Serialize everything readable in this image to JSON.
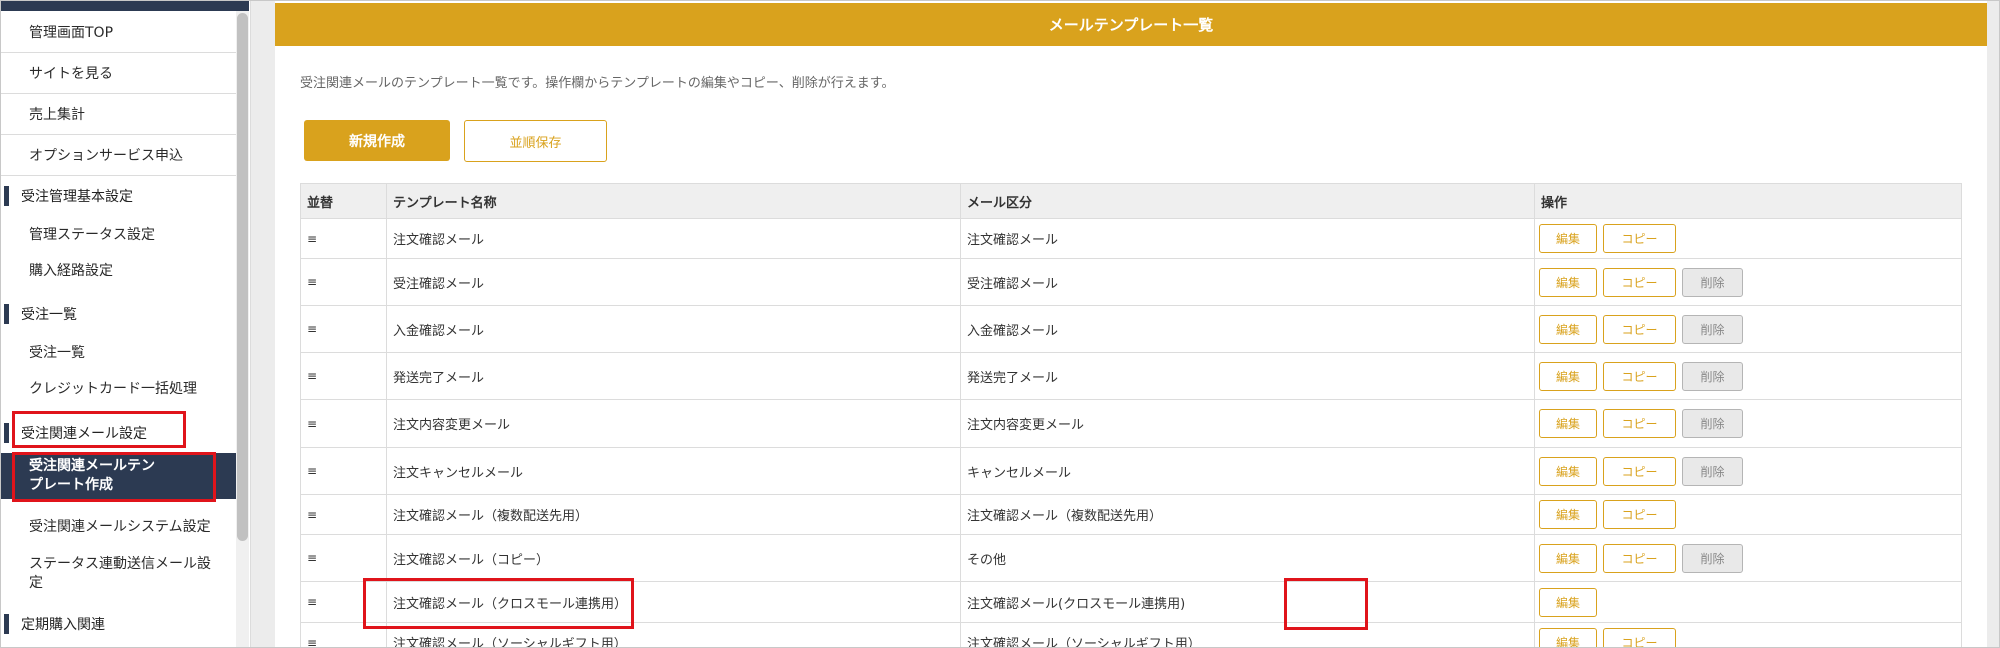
{
  "sidebar": {
    "items": [
      {
        "label": "管理画面TOP"
      },
      {
        "label": "サイトを見る"
      },
      {
        "label": "売上集計"
      },
      {
        "label": "オプションサービス申込"
      }
    ],
    "sections": [
      {
        "title": "受注管理基本設定",
        "items": [
          "管理ステータス設定",
          "購入経路設定"
        ]
      },
      {
        "title": "受注一覧",
        "items": [
          "受注一覧",
          "クレジットカード一括処理"
        ]
      },
      {
        "title": "受注関連メール設定",
        "items": [
          "受注関連メールテンプレート作成",
          "受注関連メールシステム設定",
          "ステータス連動送信メール設定"
        ]
      },
      {
        "title": "定期購入関連",
        "items": []
      }
    ]
  },
  "panel": {
    "title": "メールテンプレート一覧",
    "description": "受注関連メールのテンプレート一覧です。操作欄からテンプレートの編集やコピー、削除が行えます。",
    "new_button": "新規作成",
    "order_save_button": "並順保存"
  },
  "table": {
    "headers": [
      "並替",
      "テンプレート名称",
      "メール区分",
      "操作"
    ],
    "handle_symbol": "≡",
    "edit_label": "編集",
    "copy_label": "コピー",
    "delete_label": "削除",
    "rows": [
      {
        "name": "注文確認メール",
        "type": "注文確認メール",
        "copy": true,
        "delete": false
      },
      {
        "name": "受注確認メール",
        "type": "受注確認メール",
        "copy": true,
        "delete": true
      },
      {
        "name": "入金確認メール",
        "type": "入金確認メール",
        "copy": true,
        "delete": true
      },
      {
        "name": "発送完了メール",
        "type": "発送完了メール",
        "copy": true,
        "delete": true
      },
      {
        "name": "注文内容変更メール",
        "type": "注文内容変更メール",
        "copy": true,
        "delete": true
      },
      {
        "name": "注文キャンセルメール",
        "type": "キャンセルメール",
        "copy": true,
        "delete": true
      },
      {
        "name": "注文確認メール（複数配送先用）",
        "type": "注文確認メール（複数配送先用）",
        "copy": true,
        "delete": false
      },
      {
        "name": "注文確認メール（コピー）",
        "type": "その他",
        "copy": true,
        "delete": true
      },
      {
        "name": "注文確認メール（クロスモール連携用）",
        "type": "注文確認メール(クロスモール連携用)",
        "copy": false,
        "delete": false
      },
      {
        "name": "注文確認メール（ソーシャルギフト用）",
        "type": "注文確認メール（ソーシャルギフト用）",
        "copy": true,
        "delete": false
      }
    ]
  },
  "colors": {
    "accent": "#d9a21d",
    "sidebar_dark": "#2c3a52",
    "highlight": "#e0141b"
  }
}
